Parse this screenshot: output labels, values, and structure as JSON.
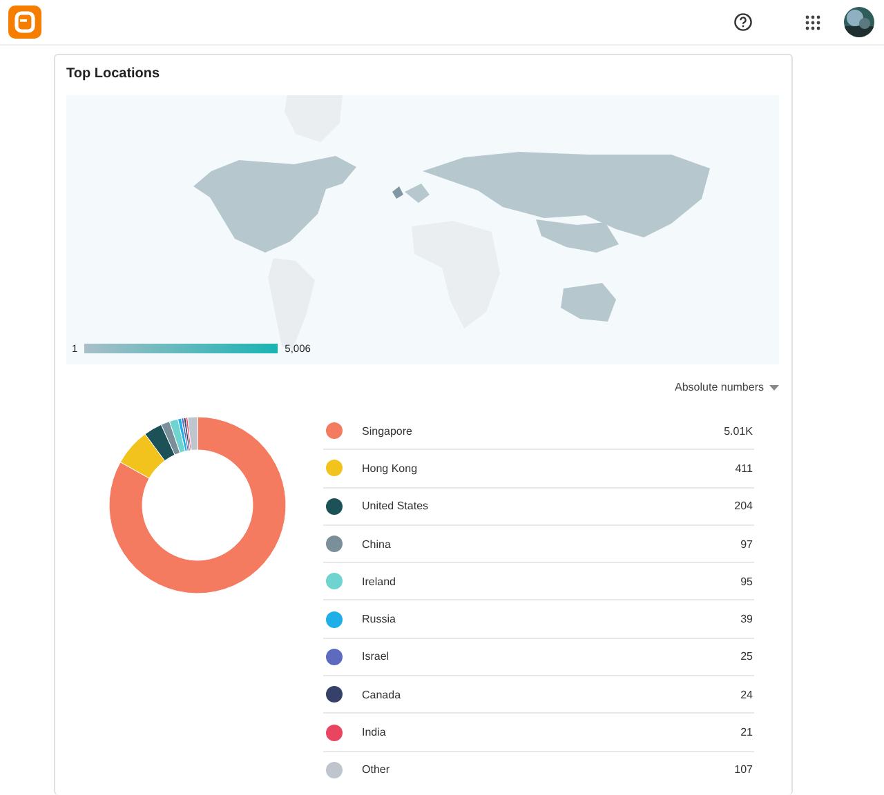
{
  "card": {
    "title": "Top Locations"
  },
  "map_legend": {
    "min": "1",
    "max": "5,006"
  },
  "metric_select": {
    "value": "Absolute numbers"
  },
  "locations": [
    {
      "value": "5.01K",
      "color": "#f47a60"
    },
    {
      "value": "411",
      "color": "#f2c31c"
    },
    {
      "value": "204",
      "color": "#1c5257"
    },
    {
      "value": "97",
      "color": "#7a8f99"
    },
    {
      "value": "95",
      "color": "#6fd4d0"
    },
    {
      "value": "39",
      "color": "#1eaee8"
    },
    {
      "value": "25",
      "color": "#5c6bc0"
    },
    {
      "value": "24",
      "color": "#36416a"
    },
    {
      "value": "21",
      "color": "#e94560"
    },
    {
      "value": "107",
      "color": "#bfc5cc"
    }
  ],
  "chart_data": {
    "type": "donut",
    "categories": [
      "Singapore",
      "Hong Kong",
      "United States",
      "China",
      "Ireland",
      "Russia",
      "Israel",
      "Canada",
      "India",
      "Other"
    ],
    "values": [
      83.1,
      6.79,
      3.37,
      1.6,
      1.57,
      0.64,
      0.41,
      0.4,
      0.35,
      1.77
    ]
  }
}
